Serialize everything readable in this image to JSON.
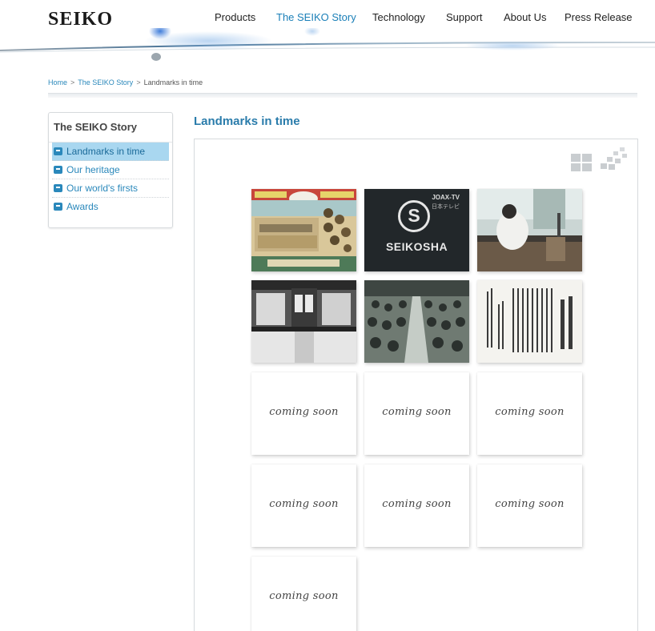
{
  "brand": {
    "logo": "SEIKO"
  },
  "nav": {
    "items": [
      {
        "label": "Products"
      },
      {
        "label": "The SEIKO Story",
        "active": true
      },
      {
        "label": "Technology"
      },
      {
        "label": "Support"
      },
      {
        "label": "About Us"
      },
      {
        "label": "Press Release"
      }
    ]
  },
  "breadcrumb": {
    "items": [
      "Home",
      "The SEIKO Story",
      "Landmarks in time"
    ],
    "separator": ">"
  },
  "sidebar": {
    "title": "The SEIKO Story",
    "items": [
      {
        "label": "Landmarks in time",
        "active": true
      },
      {
        "label": "Our heritage"
      },
      {
        "label": "Our world's firsts"
      },
      {
        "label": "Awards"
      }
    ]
  },
  "main": {
    "title": "Landmarks in time",
    "view_controls": {
      "grid_icon": "grid-view-icon",
      "scatter_icon": "scatter-view-icon"
    },
    "tiles": [
      {
        "kind": "photo",
        "subject": "vintage-factory-poster"
      },
      {
        "kind": "photo",
        "subject": "seikosha-tv-card",
        "badge_text": "SEIKOSHA",
        "corner_text": "JOAX-TV",
        "corner_sub": "日本テレビ"
      },
      {
        "kind": "photo",
        "subject": "watchmaker-at-bench"
      },
      {
        "kind": "photo",
        "subject": "factory-doorway"
      },
      {
        "kind": "photo",
        "subject": "assembly-line-workers"
      },
      {
        "kind": "photo",
        "subject": "japanese-document"
      },
      {
        "kind": "placeholder",
        "label": "coming soon"
      },
      {
        "kind": "placeholder",
        "label": "coming soon"
      },
      {
        "kind": "placeholder",
        "label": "coming soon"
      },
      {
        "kind": "placeholder",
        "label": "coming soon"
      },
      {
        "kind": "placeholder",
        "label": "coming soon"
      },
      {
        "kind": "placeholder",
        "label": "coming soon"
      },
      {
        "kind": "placeholder",
        "label": "coming soon"
      }
    ]
  },
  "colors": {
    "accent": "#2a88bb",
    "active_nav": "#1a7fb8",
    "sidebar_active_bg": "#a9d7f0",
    "text": "#333333"
  }
}
